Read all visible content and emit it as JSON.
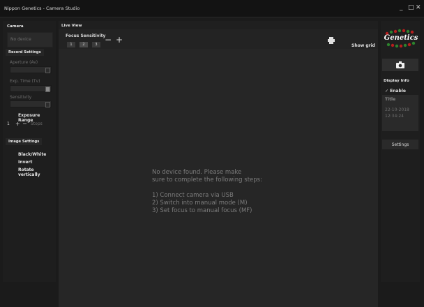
{
  "window": {
    "title": "Nippon Genetics - Camera Studio",
    "controls": {
      "minimize": "_",
      "maximize": "□",
      "close": "✕"
    }
  },
  "left": {
    "camera_header": "Camera",
    "device_value": "No device",
    "record_header": "Record Settings",
    "aperture_label": "Aperture (Av)",
    "exp_label": "Exp. Time (Tv)",
    "sensitivity_label": "Sensitivity",
    "exposure_range_label": "Exposure Range",
    "range_value": "1",
    "range_plus": "+",
    "range_minus": "−",
    "range_unit": "Stops",
    "image_header": "Image Settings",
    "image_options": [
      "Black/White",
      "Invert",
      "Rotate vertically"
    ]
  },
  "live": {
    "header": "Live View",
    "focus_label": "Focus Sensitivity",
    "focus_buttons": [
      "1",
      "2",
      "3"
    ],
    "minus_label": "−",
    "plus_label": "+",
    "print_icon": "printer-icon",
    "show_grid_label": "Show grid",
    "message_lines": [
      "No device found. Please make",
      "sure to complete the following steps:",
      "",
      "1) Connect camera via USB",
      "2) Switch into manual mode (M)",
      "3) Set focus to manual focus (MF)"
    ]
  },
  "right": {
    "logo_text": "Genetics",
    "camera_icon": "camera-icon",
    "display_info_header": "Display Info",
    "enable_label": "Enable",
    "title_label": "Title",
    "date": "22-10-2018",
    "time": "12:34:24",
    "settings_label": "Settings"
  },
  "colors": {
    "background": "#1b1b1b",
    "panel": "#262626",
    "text": "#cfcfcf",
    "muted": "#6d6d6d",
    "logo_red": "#c81e1e",
    "logo_green": "#2f8f2f"
  }
}
